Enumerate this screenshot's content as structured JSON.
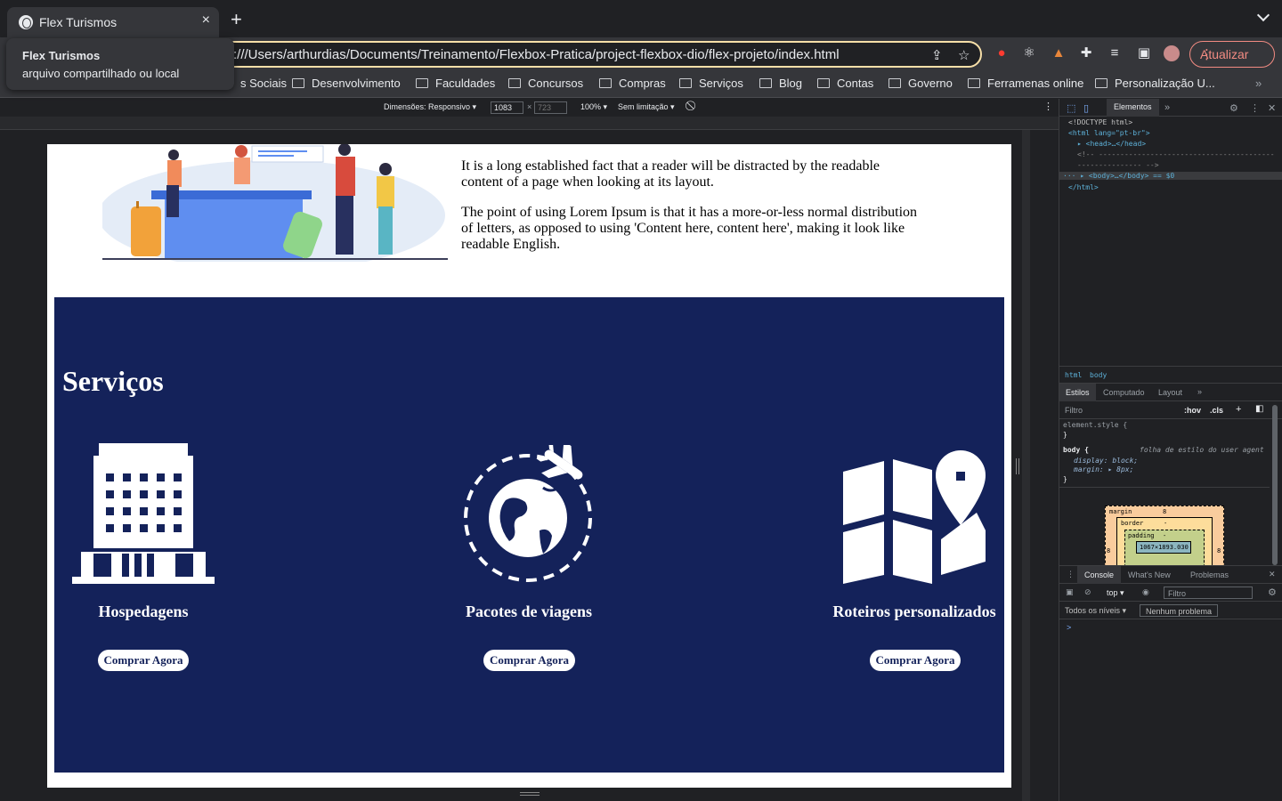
{
  "browser": {
    "tab_title": "Flex Turismos",
    "tab_close": "×",
    "new_tab": "+",
    "url": "file:///Users/arthurdias/Documents/Treinamento/Flexbox-Pratica/project-flexbox-dio/flex-projeto/index.html",
    "url_visible": ":///Users/arthurdias/Documents/Treinamento/Flexbox-Pratica/project-flexbox-dio/flex-projeto/index.html",
    "update_label": "Atualizar",
    "update_color": "#f28b82"
  },
  "tooltip": {
    "title": "Flex Turismos",
    "subtitle": "arquivo compartilhado ou local"
  },
  "bookmarks": [
    "s Sociais",
    "Desenvolvimento",
    "Faculdades",
    "Concursos",
    "Compras",
    "Serviços",
    "Blog",
    "Contas",
    "Governo",
    "Ferramenas online",
    "Personalização U..."
  ],
  "device_toolbar": {
    "dimensions_label": "Dimensões: Responsivo",
    "width": "1083",
    "times": "×",
    "height_placeholder": "723",
    "zoom": "100%",
    "throttle": "Sem limitação"
  },
  "page": {
    "intro_paragraphs": [
      "It is a long established fact that a reader will be distracted by the readable content of a page when looking at its layout.",
      "The point of using Lorem Ipsum is that it has a more-or-less normal distribution of letters, as opposed to using 'Content here, content here', making it look like readable English."
    ],
    "services_title": "Serviços",
    "services_bg": "#14225a",
    "services": [
      {
        "name": "Hospedagens",
        "button": "Comprar Agora",
        "icon": "hotel-icon"
      },
      {
        "name": "Pacotes de viagens",
        "button": "Comprar Agora",
        "icon": "globe-plane-icon"
      },
      {
        "name": "Roteiros personalizados",
        "button": "Comprar Agora",
        "icon": "map-pin-icon"
      }
    ]
  },
  "devtools": {
    "tab_elements": "Elementos",
    "dom": {
      "doctype": "<!DOCTYPE html>",
      "html_open": "<html lang=\"pt-br\">",
      "head": "<head>…</head>",
      "comment_1": "<!-- -----------------------------------------",
      "comment_2": "--------------- -->",
      "body": "<body>…</body> == $0",
      "html_close": "</html>"
    },
    "crumbs": [
      "html",
      "body"
    ],
    "style_tabs": [
      "Estilos",
      "Computado",
      "Layout"
    ],
    "filter_placeholder": "Filtro",
    "hov": ":hov",
    "cls": ".cls",
    "styles": {
      "element_style": "element.style {",
      "close": "}",
      "body_selector": "body {",
      "ua_label": "folha de estilo do user agent",
      "prop1": "display: block;",
      "prop2": "margin: ▸ 8px;"
    },
    "boxmodel": {
      "margin_label": "margin",
      "margin_val": "8",
      "border_label": "border",
      "border_val": "-",
      "padding_label": "padding",
      "padding_val": "-",
      "content": "1067×1893.030",
      "side_val": "8"
    },
    "drawer": {
      "tabs": [
        "Console",
        "What's New",
        "Problemas"
      ],
      "context": "top",
      "filter_placeholder": "Filtro",
      "levels": "Todos os níveis",
      "issues": "Nenhum problema",
      "prompt": ">"
    }
  }
}
